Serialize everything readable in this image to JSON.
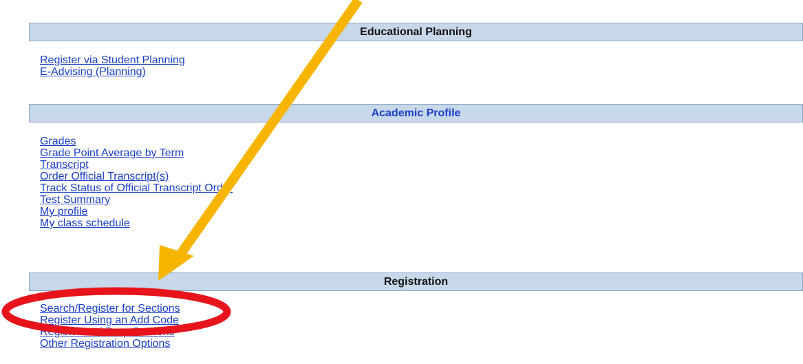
{
  "sections": [
    {
      "title": "Educational Planning",
      "links": [
        "Register via Student Planning",
        "E-Advising (Planning)"
      ]
    },
    {
      "title": "Academic Profile",
      "links": [
        "Grades",
        "Grade Point Average by Term",
        "Transcript",
        "Order Official Transcript(s)",
        "Track Status of Official Transcript Order",
        "Test Summary",
        "My profile",
        "My class schedule"
      ]
    },
    {
      "title": "Registration",
      "links": [
        "Search/Register for Sections",
        "Register Using an Add Code",
        "Register and Drop Sections",
        "Other Registration Options"
      ]
    }
  ],
  "annotations": {
    "arrow_color": "#f7b500",
    "highlight_color": "#e8141b"
  }
}
